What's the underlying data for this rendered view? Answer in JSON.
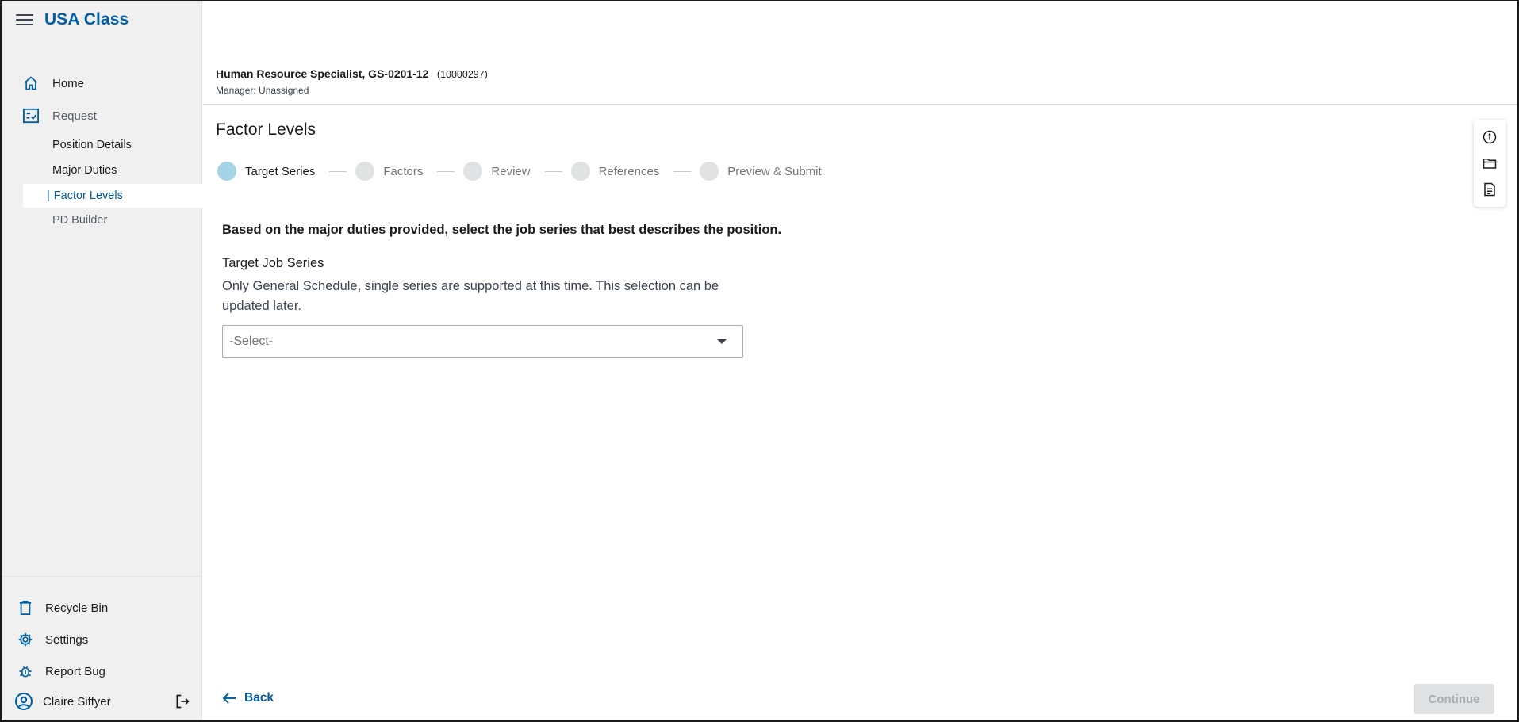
{
  "app": {
    "title": "USA Class"
  },
  "sidebar": {
    "items": [
      {
        "label": "Home",
        "icon": "home-icon"
      },
      {
        "label": "Request",
        "icon": "request-checklist-icon"
      }
    ],
    "sub_items": [
      {
        "label": "Position Details"
      },
      {
        "label": "Major Duties"
      },
      {
        "label": "Factor Levels",
        "active": true
      },
      {
        "label": "PD Builder"
      }
    ],
    "bottom_items": [
      {
        "label": "Recycle Bin",
        "icon": "trash-icon"
      },
      {
        "label": "Settings",
        "icon": "gear-icon"
      },
      {
        "label": "Report Bug",
        "icon": "bug-icon"
      }
    ],
    "user": {
      "name": "Claire Siffyer"
    }
  },
  "position": {
    "title": "Human Resource Specialist, GS-0201-12",
    "id": "(10000297)",
    "manager": "Manager: Unassigned"
  },
  "page": {
    "title": "Factor Levels"
  },
  "stepper": {
    "steps": [
      {
        "label": "Target Series",
        "current": true
      },
      {
        "label": "Factors"
      },
      {
        "label": "Review"
      },
      {
        "label": "References"
      },
      {
        "label": "Preview & Submit"
      }
    ]
  },
  "form": {
    "question": "Based on the major duties provided, select the job series that best describes the position.",
    "label": "Target Job Series",
    "hint": "Only General Schedule, single series are supported at this time. This selection can be updated later.",
    "select_placeholder": "-Select-"
  },
  "actions": {
    "back": "Back",
    "continue": "Continue"
  },
  "colors": {
    "accent": "#005ea2",
    "current_step": "#a6d3e6",
    "sidebar_bg": "#f0f0f0"
  }
}
